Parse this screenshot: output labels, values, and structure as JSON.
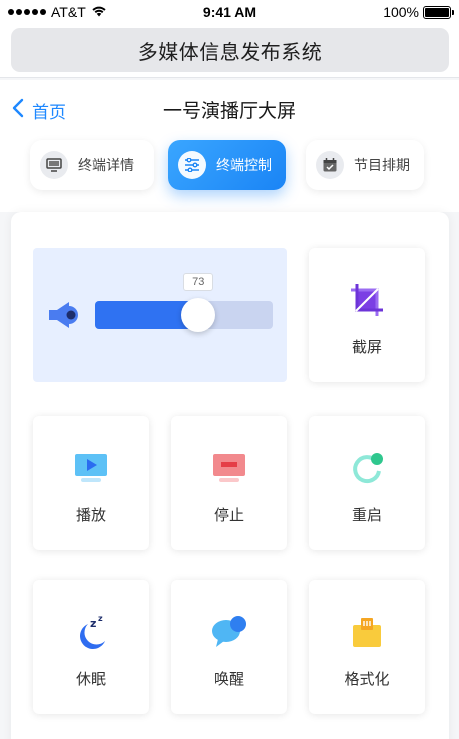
{
  "status_bar": {
    "carrier": "AT&T",
    "time": "9:41 AM",
    "battery": "100%"
  },
  "app_title": "多媒体信息发布系统",
  "nav": {
    "back_label": "首页",
    "title": "一号演播厅大屏"
  },
  "tabs": [
    {
      "label": "终端详情",
      "icon": "monitor-icon",
      "active": false
    },
    {
      "label": "终端控制",
      "icon": "sliders-icon",
      "active": true
    },
    {
      "label": "节目排期",
      "icon": "calendar-icon",
      "active": false
    }
  ],
  "volume": {
    "value": "73",
    "level": 0.58
  },
  "controls": [
    {
      "label": "截屏",
      "icon": "crop-icon"
    },
    {
      "label": "播放",
      "icon": "play-icon"
    },
    {
      "label": "停止",
      "icon": "stop-icon"
    },
    {
      "label": "重启",
      "icon": "restart-icon"
    },
    {
      "label": "休眠",
      "icon": "sleep-icon"
    },
    {
      "label": "唤醒",
      "icon": "wake-icon"
    },
    {
      "label": "格式化",
      "icon": "format-icon"
    }
  ],
  "colors": {
    "accent": "#1a84f5",
    "slider_fill": "#2f72f2",
    "slider_track": "#c9d4f0",
    "volume_bg": "#e7efff"
  }
}
